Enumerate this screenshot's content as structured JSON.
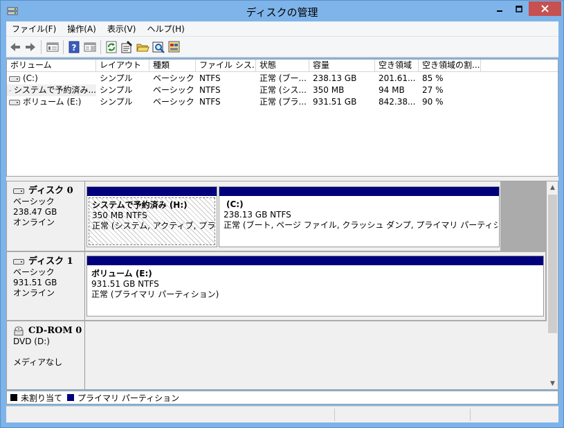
{
  "window": {
    "title": "ディスクの管理"
  },
  "menu": [
    "ファイル(F)",
    "操作(A)",
    "表示(V)",
    "ヘルプ(H)"
  ],
  "toolbar": {
    "buttons": [
      "back-icon",
      "forward-icon",
      "console-tree-icon",
      "help-icon",
      "properties-pane-icon",
      "refresh-icon",
      "properties-icon",
      "open-icon",
      "explore-icon",
      "settings-icon"
    ]
  },
  "columns": [
    "ボリューム",
    "レイアウト",
    "種類",
    "ファイル シス...",
    "状態",
    "容量",
    "空き領域",
    "空き領域の割..."
  ],
  "volumes": [
    {
      "name": "(C:)",
      "layout": "シンプル",
      "type": "ベーシック",
      "fs": "NTFS",
      "status": "正常 (ブー...",
      "capacity": "238.13 GB",
      "free": "201.61...",
      "pct": "85 %"
    },
    {
      "name": "システムで予約済み...",
      "layout": "シンプル",
      "type": "ベーシック",
      "fs": "NTFS",
      "status": "正常 (シス...",
      "capacity": "350 MB",
      "free": "94 MB",
      "pct": "27 %"
    },
    {
      "name": "ボリューム (E:)",
      "layout": "シンプル",
      "type": "ベーシック",
      "fs": "NTFS",
      "status": "正常 (プラ...",
      "capacity": "931.51 GB",
      "free": "842.38...",
      "pct": "90 %"
    }
  ],
  "disks": [
    {
      "name": "ディスク 0",
      "kind": "ベーシック",
      "size": "238.47 GB",
      "state": "オンライン",
      "partitions": [
        {
          "name": "システムで予約済み  (H:)",
          "size": "350 MB NTFS",
          "status": "正常 (システム, アクティブ, プライマリ"
        },
        {
          "name": "(C:)",
          "size": "238.13 GB NTFS",
          "status": "正常 (ブート, ページ ファイル, クラッシュ ダンプ, プライマリ パーティション)"
        }
      ]
    },
    {
      "name": "ディスク 1",
      "kind": "ベーシック",
      "size": "931.51 GB",
      "state": "オンライン",
      "partitions": [
        {
          "name": "ボリューム  (E:)",
          "size": "931.51 GB NTFS",
          "status": "正常 (プライマリ パーティション)"
        }
      ]
    },
    {
      "name": "CD-ROM 0",
      "kind": "DVD (D:)",
      "size": "",
      "state": "メディアなし"
    }
  ],
  "legend": [
    {
      "label": "未割り当て",
      "color": "#000000"
    },
    {
      "label": "プライマリ パーティション",
      "color": "#00007c"
    }
  ],
  "colors": {
    "partition_bar": "#00007c",
    "title_bar": "#7eb4ea",
    "close_button": "#c75050"
  }
}
